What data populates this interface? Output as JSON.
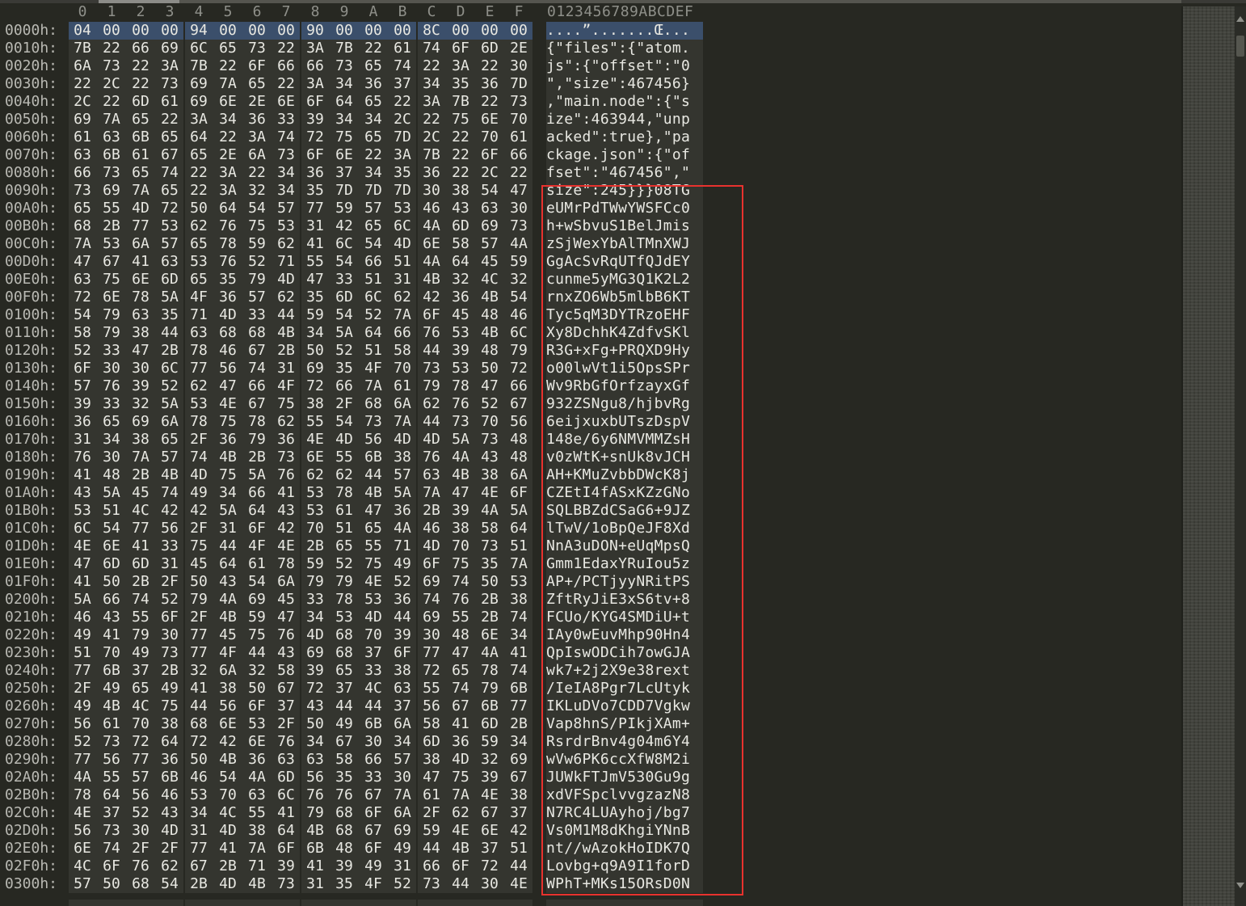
{
  "header": {
    "columns": [
      "0",
      "1",
      "2",
      "3",
      "4",
      "5",
      "6",
      "7",
      "8",
      "9",
      "A",
      "B",
      "C",
      "D",
      "E",
      "F"
    ],
    "ascii_label": "0123456789ABCDEF"
  },
  "rows": [
    {
      "addr": "0000h:",
      "bytes": [
        "04",
        "00",
        "00",
        "00",
        "94",
        "00",
        "00",
        "00",
        "90",
        "00",
        "00",
        "00",
        "8C",
        "00",
        "00",
        "00"
      ],
      "ascii": "....”.......Œ...",
      "selected": true
    },
    {
      "addr": "0010h:",
      "bytes": [
        "7B",
        "22",
        "66",
        "69",
        "6C",
        "65",
        "73",
        "22",
        "3A",
        "7B",
        "22",
        "61",
        "74",
        "6F",
        "6D",
        "2E"
      ],
      "ascii": "{\"files\":{\"atom."
    },
    {
      "addr": "0020h:",
      "bytes": [
        "6A",
        "73",
        "22",
        "3A",
        "7B",
        "22",
        "6F",
        "66",
        "66",
        "73",
        "65",
        "74",
        "22",
        "3A",
        "22",
        "30"
      ],
      "ascii": "js\":{\"offset\":\"0"
    },
    {
      "addr": "0030h:",
      "bytes": [
        "22",
        "2C",
        "22",
        "73",
        "69",
        "7A",
        "65",
        "22",
        "3A",
        "34",
        "36",
        "37",
        "34",
        "35",
        "36",
        "7D"
      ],
      "ascii": "\",\"size\":467456}"
    },
    {
      "addr": "0040h:",
      "bytes": [
        "2C",
        "22",
        "6D",
        "61",
        "69",
        "6E",
        "2E",
        "6E",
        "6F",
        "64",
        "65",
        "22",
        "3A",
        "7B",
        "22",
        "73"
      ],
      "ascii": ",\"main.node\":{\"s"
    },
    {
      "addr": "0050h:",
      "bytes": [
        "69",
        "7A",
        "65",
        "22",
        "3A",
        "34",
        "36",
        "33",
        "39",
        "34",
        "34",
        "2C",
        "22",
        "75",
        "6E",
        "70"
      ],
      "ascii": "ize\":463944,\"unp"
    },
    {
      "addr": "0060h:",
      "bytes": [
        "61",
        "63",
        "6B",
        "65",
        "64",
        "22",
        "3A",
        "74",
        "72",
        "75",
        "65",
        "7D",
        "2C",
        "22",
        "70",
        "61"
      ],
      "ascii": "acked\":true},\"pa"
    },
    {
      "addr": "0070h:",
      "bytes": [
        "63",
        "6B",
        "61",
        "67",
        "65",
        "2E",
        "6A",
        "73",
        "6F",
        "6E",
        "22",
        "3A",
        "7B",
        "22",
        "6F",
        "66"
      ],
      "ascii": "ckage.json\":{\"of"
    },
    {
      "addr": "0080h:",
      "bytes": [
        "66",
        "73",
        "65",
        "74",
        "22",
        "3A",
        "22",
        "34",
        "36",
        "37",
        "34",
        "35",
        "36",
        "22",
        "2C",
        "22"
      ],
      "ascii": "fset\":\"467456\",\""
    },
    {
      "addr": "0090h:",
      "bytes": [
        "73",
        "69",
        "7A",
        "65",
        "22",
        "3A",
        "32",
        "34",
        "35",
        "7D",
        "7D",
        "7D",
        "30",
        "38",
        "54",
        "47"
      ],
      "ascii": "size\":245}}}08TG"
    },
    {
      "addr": "00A0h:",
      "bytes": [
        "65",
        "55",
        "4D",
        "72",
        "50",
        "64",
        "54",
        "57",
        "77",
        "59",
        "57",
        "53",
        "46",
        "43",
        "63",
        "30"
      ],
      "ascii": "eUMrPdTWwYWSFCc0"
    },
    {
      "addr": "00B0h:",
      "bytes": [
        "68",
        "2B",
        "77",
        "53",
        "62",
        "76",
        "75",
        "53",
        "31",
        "42",
        "65",
        "6C",
        "4A",
        "6D",
        "69",
        "73"
      ],
      "ascii": "h+wSbvuS1BelJmis"
    },
    {
      "addr": "00C0h:",
      "bytes": [
        "7A",
        "53",
        "6A",
        "57",
        "65",
        "78",
        "59",
        "62",
        "41",
        "6C",
        "54",
        "4D",
        "6E",
        "58",
        "57",
        "4A"
      ],
      "ascii": "zSjWexYbAlTMnXWJ"
    },
    {
      "addr": "00D0h:",
      "bytes": [
        "47",
        "67",
        "41",
        "63",
        "53",
        "76",
        "52",
        "71",
        "55",
        "54",
        "66",
        "51",
        "4A",
        "64",
        "45",
        "59"
      ],
      "ascii": "GgAcSvRqUTfQJdEY"
    },
    {
      "addr": "00E0h:",
      "bytes": [
        "63",
        "75",
        "6E",
        "6D",
        "65",
        "35",
        "79",
        "4D",
        "47",
        "33",
        "51",
        "31",
        "4B",
        "32",
        "4C",
        "32"
      ],
      "ascii": "cunme5yMG3Q1K2L2"
    },
    {
      "addr": "00F0h:",
      "bytes": [
        "72",
        "6E",
        "78",
        "5A",
        "4F",
        "36",
        "57",
        "62",
        "35",
        "6D",
        "6C",
        "62",
        "42",
        "36",
        "4B",
        "54"
      ],
      "ascii": "rnxZO6Wb5mlbB6KT"
    },
    {
      "addr": "0100h:",
      "bytes": [
        "54",
        "79",
        "63",
        "35",
        "71",
        "4D",
        "33",
        "44",
        "59",
        "54",
        "52",
        "7A",
        "6F",
        "45",
        "48",
        "46"
      ],
      "ascii": "Tyc5qM3DYTRzoEHF"
    },
    {
      "addr": "0110h:",
      "bytes": [
        "58",
        "79",
        "38",
        "44",
        "63",
        "68",
        "68",
        "4B",
        "34",
        "5A",
        "64",
        "66",
        "76",
        "53",
        "4B",
        "6C"
      ],
      "ascii": "Xy8DchhK4ZdfvSKl"
    },
    {
      "addr": "0120h:",
      "bytes": [
        "52",
        "33",
        "47",
        "2B",
        "78",
        "46",
        "67",
        "2B",
        "50",
        "52",
        "51",
        "58",
        "44",
        "39",
        "48",
        "79"
      ],
      "ascii": "R3G+xFg+PRQXD9Hy"
    },
    {
      "addr": "0130h:",
      "bytes": [
        "6F",
        "30",
        "30",
        "6C",
        "77",
        "56",
        "74",
        "31",
        "69",
        "35",
        "4F",
        "70",
        "73",
        "53",
        "50",
        "72"
      ],
      "ascii": "o00lwVt1i5OpsSPr"
    },
    {
      "addr": "0140h:",
      "bytes": [
        "57",
        "76",
        "39",
        "52",
        "62",
        "47",
        "66",
        "4F",
        "72",
        "66",
        "7A",
        "61",
        "79",
        "78",
        "47",
        "66"
      ],
      "ascii": "Wv9RbGfOrfzayxGf"
    },
    {
      "addr": "0150h:",
      "bytes": [
        "39",
        "33",
        "32",
        "5A",
        "53",
        "4E",
        "67",
        "75",
        "38",
        "2F",
        "68",
        "6A",
        "62",
        "76",
        "52",
        "67"
      ],
      "ascii": "932ZSNgu8/hjbvRg"
    },
    {
      "addr": "0160h:",
      "bytes": [
        "36",
        "65",
        "69",
        "6A",
        "78",
        "75",
        "78",
        "62",
        "55",
        "54",
        "73",
        "7A",
        "44",
        "73",
        "70",
        "56"
      ],
      "ascii": "6eijxuxbUTszDspV"
    },
    {
      "addr": "0170h:",
      "bytes": [
        "31",
        "34",
        "38",
        "65",
        "2F",
        "36",
        "79",
        "36",
        "4E",
        "4D",
        "56",
        "4D",
        "4D",
        "5A",
        "73",
        "48"
      ],
      "ascii": "148e/6y6NMVMMZsH"
    },
    {
      "addr": "0180h:",
      "bytes": [
        "76",
        "30",
        "7A",
        "57",
        "74",
        "4B",
        "2B",
        "73",
        "6E",
        "55",
        "6B",
        "38",
        "76",
        "4A",
        "43",
        "48"
      ],
      "ascii": "v0zWtK+snUk8vJCH"
    },
    {
      "addr": "0190h:",
      "bytes": [
        "41",
        "48",
        "2B",
        "4B",
        "4D",
        "75",
        "5A",
        "76",
        "62",
        "62",
        "44",
        "57",
        "63",
        "4B",
        "38",
        "6A"
      ],
      "ascii": "AH+KMuZvbbDWcK8j"
    },
    {
      "addr": "01A0h:",
      "bytes": [
        "43",
        "5A",
        "45",
        "74",
        "49",
        "34",
        "66",
        "41",
        "53",
        "78",
        "4B",
        "5A",
        "7A",
        "47",
        "4E",
        "6F"
      ],
      "ascii": "CZEtI4fASxKZzGNo"
    },
    {
      "addr": "01B0h:",
      "bytes": [
        "53",
        "51",
        "4C",
        "42",
        "42",
        "5A",
        "64",
        "43",
        "53",
        "61",
        "47",
        "36",
        "2B",
        "39",
        "4A",
        "5A"
      ],
      "ascii": "SQLBBZdCSaG6+9JZ"
    },
    {
      "addr": "01C0h:",
      "bytes": [
        "6C",
        "54",
        "77",
        "56",
        "2F",
        "31",
        "6F",
        "42",
        "70",
        "51",
        "65",
        "4A",
        "46",
        "38",
        "58",
        "64"
      ],
      "ascii": "lTwV/1oBpQeJF8Xd"
    },
    {
      "addr": "01D0h:",
      "bytes": [
        "4E",
        "6E",
        "41",
        "33",
        "75",
        "44",
        "4F",
        "4E",
        "2B",
        "65",
        "55",
        "71",
        "4D",
        "70",
        "73",
        "51"
      ],
      "ascii": "NnA3uDON+eUqMpsQ"
    },
    {
      "addr": "01E0h:",
      "bytes": [
        "47",
        "6D",
        "6D",
        "31",
        "45",
        "64",
        "61",
        "78",
        "59",
        "52",
        "75",
        "49",
        "6F",
        "75",
        "35",
        "7A"
      ],
      "ascii": "Gmm1EdaxYRuIou5z"
    },
    {
      "addr": "01F0h:",
      "bytes": [
        "41",
        "50",
        "2B",
        "2F",
        "50",
        "43",
        "54",
        "6A",
        "79",
        "79",
        "4E",
        "52",
        "69",
        "74",
        "50",
        "53"
      ],
      "ascii": "AP+/PCTjyyNRitPS"
    },
    {
      "addr": "0200h:",
      "bytes": [
        "5A",
        "66",
        "74",
        "52",
        "79",
        "4A",
        "69",
        "45",
        "33",
        "78",
        "53",
        "36",
        "74",
        "76",
        "2B",
        "38"
      ],
      "ascii": "ZftRyJiE3xS6tv+8"
    },
    {
      "addr": "0210h:",
      "bytes": [
        "46",
        "43",
        "55",
        "6F",
        "2F",
        "4B",
        "59",
        "47",
        "34",
        "53",
        "4D",
        "44",
        "69",
        "55",
        "2B",
        "74"
      ],
      "ascii": "FCUo/KYG4SMDiU+t"
    },
    {
      "addr": "0220h:",
      "bytes": [
        "49",
        "41",
        "79",
        "30",
        "77",
        "45",
        "75",
        "76",
        "4D",
        "68",
        "70",
        "39",
        "30",
        "48",
        "6E",
        "34"
      ],
      "ascii": "IAy0wEuvMhp90Hn4"
    },
    {
      "addr": "0230h:",
      "bytes": [
        "51",
        "70",
        "49",
        "73",
        "77",
        "4F",
        "44",
        "43",
        "69",
        "68",
        "37",
        "6F",
        "77",
        "47",
        "4A",
        "41"
      ],
      "ascii": "QpIswODCih7owGJA"
    },
    {
      "addr": "0240h:",
      "bytes": [
        "77",
        "6B",
        "37",
        "2B",
        "32",
        "6A",
        "32",
        "58",
        "39",
        "65",
        "33",
        "38",
        "72",
        "65",
        "78",
        "74"
      ],
      "ascii": "wk7+2j2X9e38rext"
    },
    {
      "addr": "0250h:",
      "bytes": [
        "2F",
        "49",
        "65",
        "49",
        "41",
        "38",
        "50",
        "67",
        "72",
        "37",
        "4C",
        "63",
        "55",
        "74",
        "79",
        "6B"
      ],
      "ascii": "/IeIA8Pgr7LcUtyk"
    },
    {
      "addr": "0260h:",
      "bytes": [
        "49",
        "4B",
        "4C",
        "75",
        "44",
        "56",
        "6F",
        "37",
        "43",
        "44",
        "44",
        "37",
        "56",
        "67",
        "6B",
        "77"
      ],
      "ascii": "IKLuDVo7CDD7Vgkw"
    },
    {
      "addr": "0270h:",
      "bytes": [
        "56",
        "61",
        "70",
        "38",
        "68",
        "6E",
        "53",
        "2F",
        "50",
        "49",
        "6B",
        "6A",
        "58",
        "41",
        "6D",
        "2B"
      ],
      "ascii": "Vap8hnS/PIkjXAm+"
    },
    {
      "addr": "0280h:",
      "bytes": [
        "52",
        "73",
        "72",
        "64",
        "72",
        "42",
        "6E",
        "76",
        "34",
        "67",
        "30",
        "34",
        "6D",
        "36",
        "59",
        "34"
      ],
      "ascii": "RsrdrBnv4g04m6Y4"
    },
    {
      "addr": "0290h:",
      "bytes": [
        "77",
        "56",
        "77",
        "36",
        "50",
        "4B",
        "36",
        "63",
        "63",
        "58",
        "66",
        "57",
        "38",
        "4D",
        "32",
        "69"
      ],
      "ascii": "wVw6PK6ccXfW8M2i"
    },
    {
      "addr": "02A0h:",
      "bytes": [
        "4A",
        "55",
        "57",
        "6B",
        "46",
        "54",
        "4A",
        "6D",
        "56",
        "35",
        "33",
        "30",
        "47",
        "75",
        "39",
        "67"
      ],
      "ascii": "JUWkFTJmV530Gu9g"
    },
    {
      "addr": "02B0h:",
      "bytes": [
        "78",
        "64",
        "56",
        "46",
        "53",
        "70",
        "63",
        "6C",
        "76",
        "76",
        "67",
        "7A",
        "61",
        "7A",
        "4E",
        "38"
      ],
      "ascii": "xdVFSpclvvgzazN8"
    },
    {
      "addr": "02C0h:",
      "bytes": [
        "4E",
        "37",
        "52",
        "43",
        "34",
        "4C",
        "55",
        "41",
        "79",
        "68",
        "6F",
        "6A",
        "2F",
        "62",
        "67",
        "37"
      ],
      "ascii": "N7RC4LUAyhoj/bg7"
    },
    {
      "addr": "02D0h:",
      "bytes": [
        "56",
        "73",
        "30",
        "4D",
        "31",
        "4D",
        "38",
        "64",
        "4B",
        "68",
        "67",
        "69",
        "59",
        "4E",
        "6E",
        "42"
      ],
      "ascii": "Vs0M1M8dKhgiYNnB"
    },
    {
      "addr": "02E0h:",
      "bytes": [
        "6E",
        "74",
        "2F",
        "2F",
        "77",
        "41",
        "7A",
        "6F",
        "6B",
        "48",
        "6F",
        "49",
        "44",
        "4B",
        "37",
        "51"
      ],
      "ascii": "nt//wAzokHoIDK7Q"
    },
    {
      "addr": "02F0h:",
      "bytes": [
        "4C",
        "6F",
        "76",
        "62",
        "67",
        "2B",
        "71",
        "39",
        "41",
        "39",
        "49",
        "31",
        "66",
        "6F",
        "72",
        "44"
      ],
      "ascii": "Lovbg+q9A9I1forD"
    },
    {
      "addr": "0300h:",
      "bytes": [
        "57",
        "50",
        "68",
        "54",
        "2B",
        "4D",
        "4B",
        "73",
        "31",
        "35",
        "4F",
        "52",
        "73",
        "44",
        "30",
        "4E"
      ],
      "ascii": "WPhT+MKs15ORsD0N"
    }
  ],
  "colors": {
    "background": "#272822",
    "selection": "#3b4f6b",
    "highlight_box": "#e8322e"
  }
}
